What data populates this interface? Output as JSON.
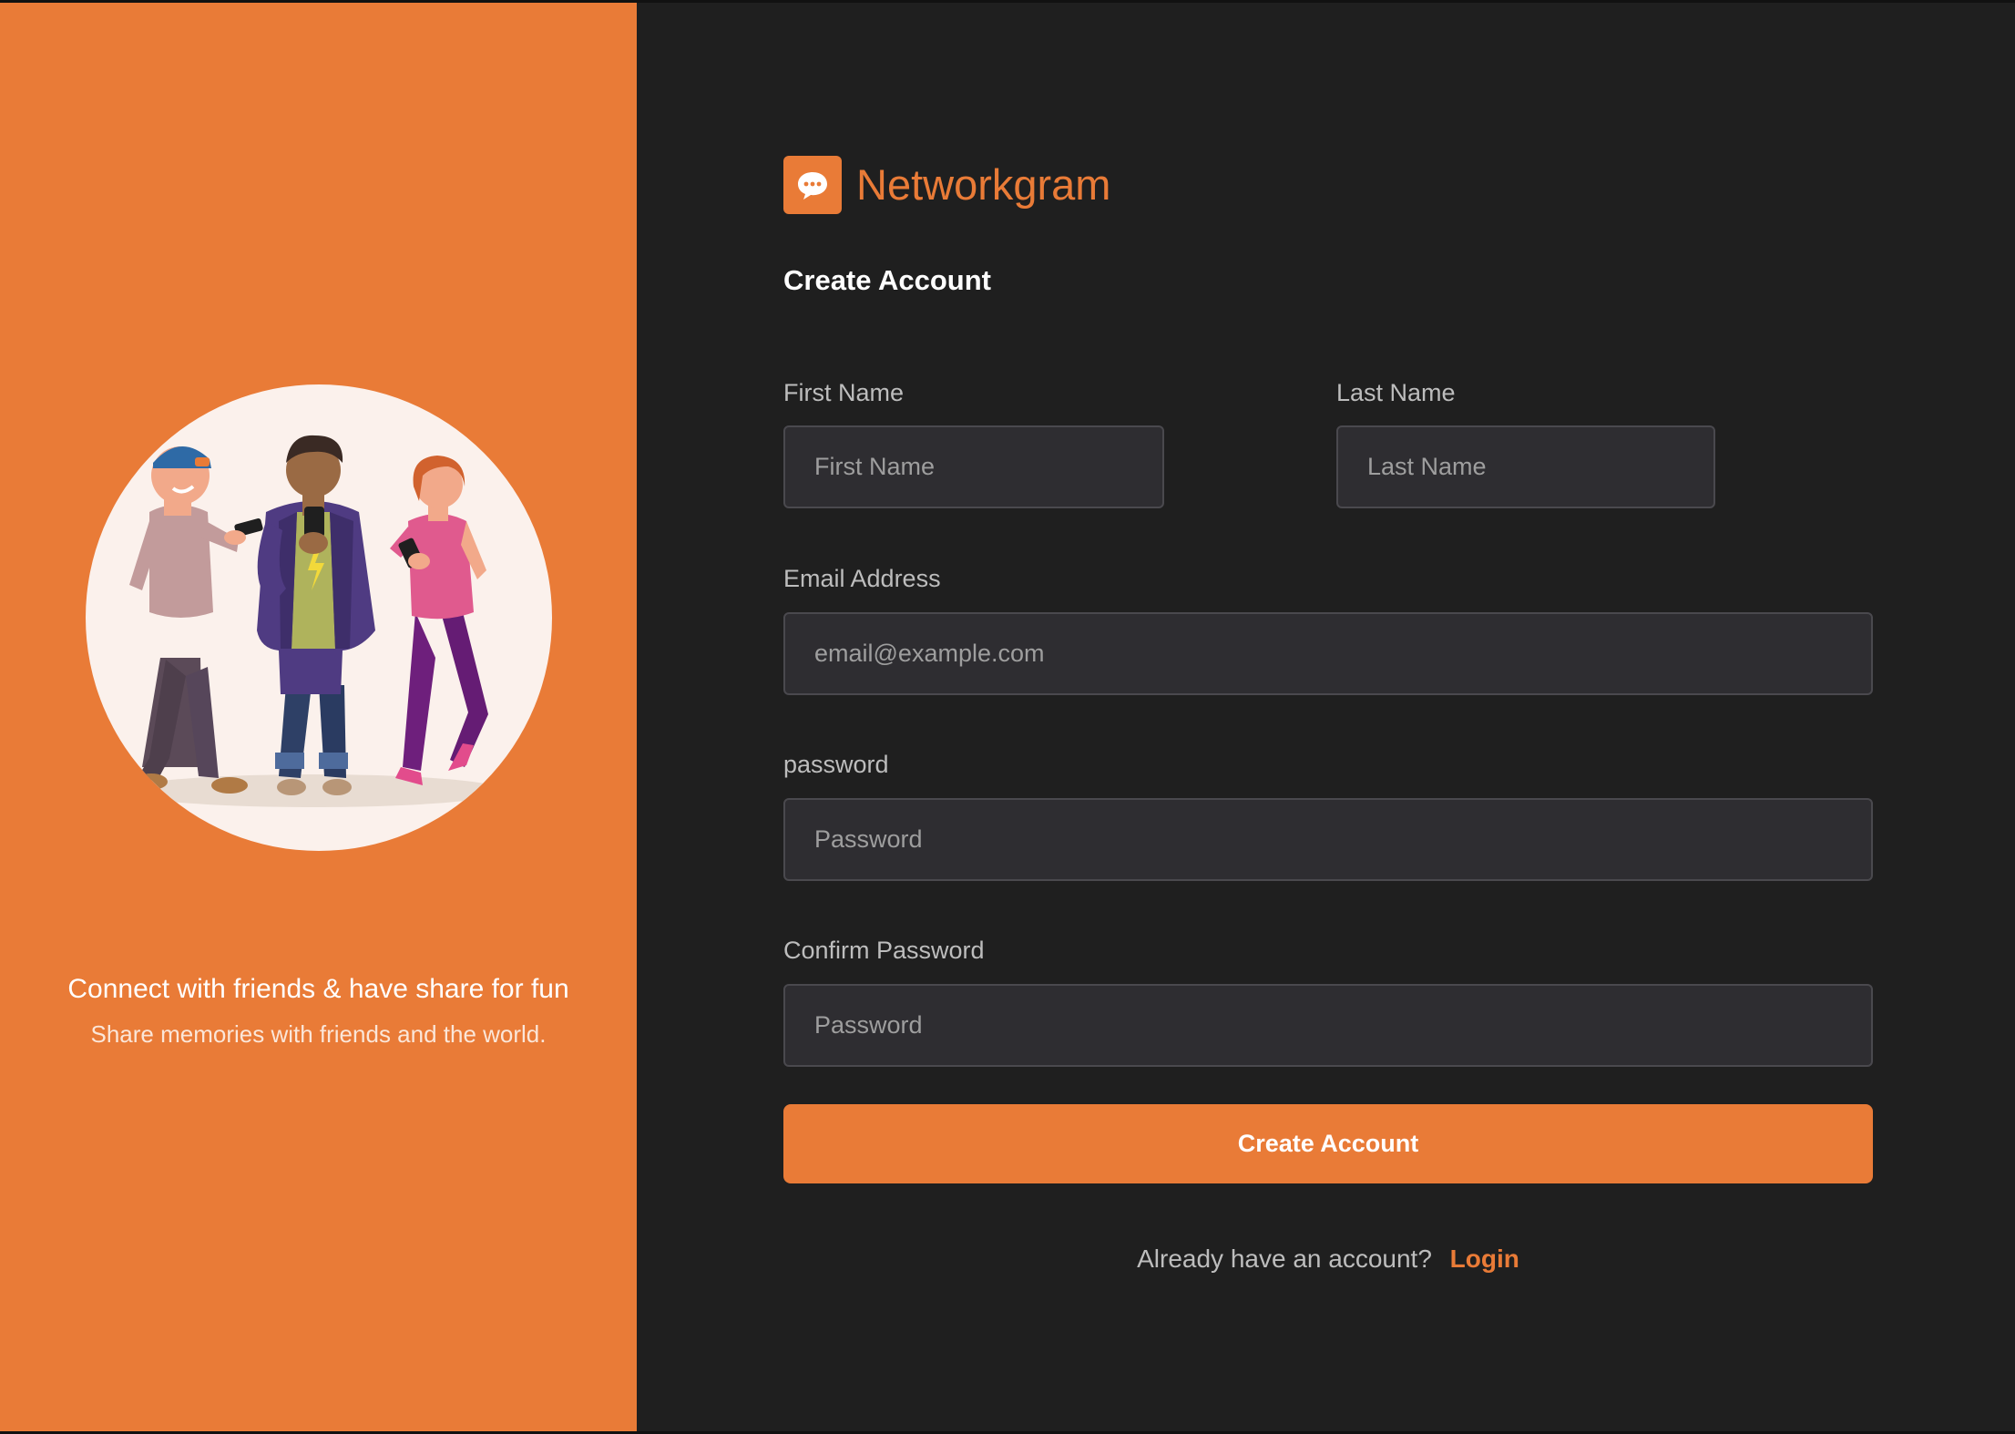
{
  "brand": {
    "logo_icon": "chat-bubble-icon",
    "name": "Networkgram",
    "accent_color": "#E97B37"
  },
  "promo": {
    "illustration": "three-friends-with-phones",
    "title": "Connect with friends & have share for fun",
    "subtitle": "Share memories with friends and the world."
  },
  "form": {
    "heading": "Create Account",
    "first_name": {
      "label": "First Name",
      "placeholder": "First Name",
      "value": ""
    },
    "last_name": {
      "label": "Last Name",
      "placeholder": "Last Name",
      "value": ""
    },
    "email": {
      "label": "Email Address",
      "placeholder": "email@example.com",
      "value": ""
    },
    "password": {
      "label": "password",
      "placeholder": "Password",
      "value": ""
    },
    "confirm_password": {
      "label": "Confirm Password",
      "placeholder": "Password",
      "value": ""
    },
    "submit_label": "Create Account"
  },
  "footer": {
    "prompt": "Already have an account?",
    "login_label": "Login"
  }
}
